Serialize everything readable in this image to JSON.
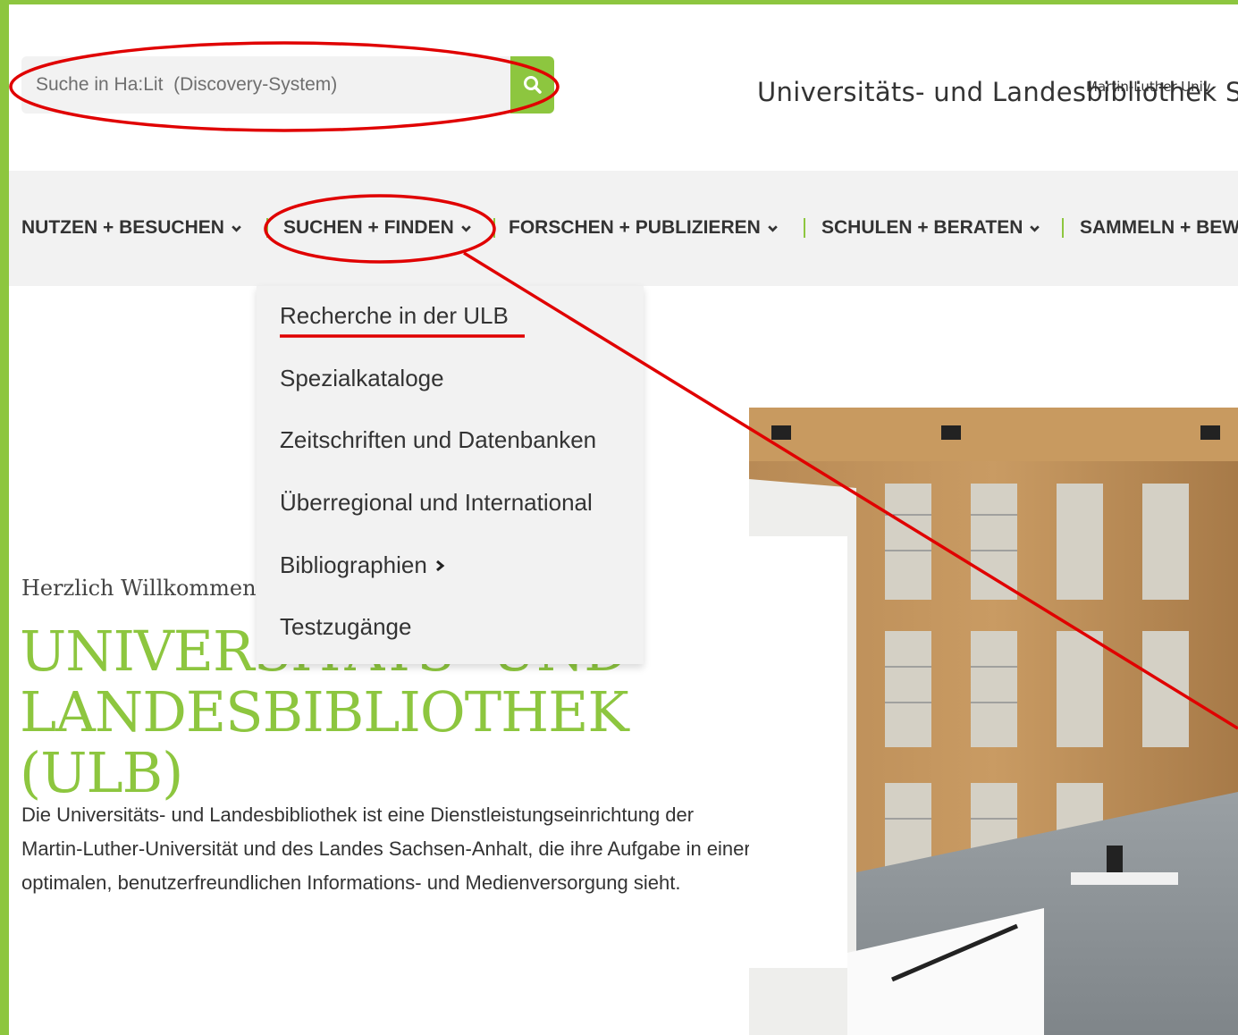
{
  "search": {
    "placeholder": "Suche in Ha:Lit  (Discovery-System)",
    "button_icon": "search-icon"
  },
  "institution": {
    "parent": "Martin-Luther-Univ",
    "name": "Universitäts- und Landesbibliothek Sa"
  },
  "nav": {
    "items": [
      {
        "label": "NUTZEN + BESUCHEN"
      },
      {
        "label": "SUCHEN + FINDEN"
      },
      {
        "label": "FORSCHEN + PUBLIZIEREN"
      },
      {
        "label": "SCHULEN + BERATEN"
      },
      {
        "label": "SAMMELN + BEW"
      }
    ]
  },
  "dropdown": {
    "items": [
      {
        "label": "Recherche in der ULB"
      },
      {
        "label": "Spezialkataloge"
      },
      {
        "label": "Zeitschriften und Datenbanken"
      },
      {
        "label": "Überregional und International"
      },
      {
        "label": "Bibliographien"
      },
      {
        "label": "Testzugänge"
      }
    ]
  },
  "hero": {
    "welcome": "Herzlich Willkommen",
    "title_line1": "UNIVERSITÄTS- UND",
    "title_line2": "LANDESBIBLIOTHEK (ULB)",
    "intro": "Die Universitäts- und Landesbibliothek ist eine Dienstleistungseinrichtung der Martin-Luther-Universität und des Landes Sachsen-Anhalt, die ihre Aufgabe in einer optimalen, benutzerfreundlichen Informations- und Medienversorgung sieht."
  },
  "colors": {
    "accent": "#8dc63f",
    "annotation": "#e00000",
    "nav_bg": "#f2f2f2"
  }
}
